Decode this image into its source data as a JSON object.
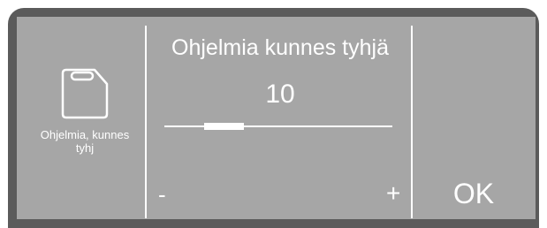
{
  "left_panel": {
    "icon": "canister-icon",
    "caption_line1": "Ohjelmia, kunnes",
    "caption_line2": "tyhj"
  },
  "setting": {
    "title": "Ohjelmia kunnes tyhjä",
    "value": "10",
    "slider_fraction": 0.21,
    "decrease_label": "-",
    "increase_label": "+"
  },
  "confirm": {
    "label": "OK"
  },
  "colors": {
    "bezel": "#5b5b5b",
    "screen": "#a6a6a6",
    "foreground": "#ffffff"
  }
}
